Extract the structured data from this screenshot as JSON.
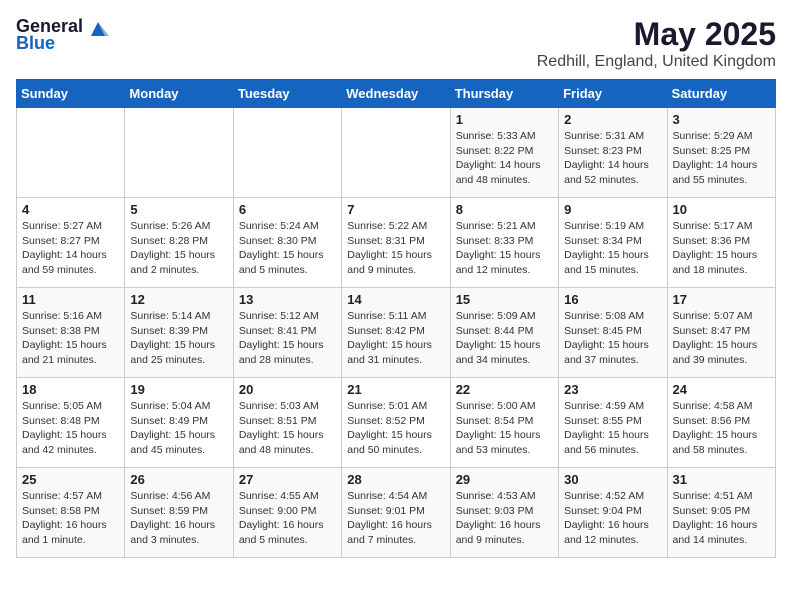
{
  "logo": {
    "general": "General",
    "blue": "Blue"
  },
  "title": "May 2025",
  "subtitle": "Redhill, England, United Kingdom",
  "headers": [
    "Sunday",
    "Monday",
    "Tuesday",
    "Wednesday",
    "Thursday",
    "Friday",
    "Saturday"
  ],
  "weeks": [
    [
      {
        "day": "",
        "info": ""
      },
      {
        "day": "",
        "info": ""
      },
      {
        "day": "",
        "info": ""
      },
      {
        "day": "",
        "info": ""
      },
      {
        "day": "1",
        "info": "Sunrise: 5:33 AM\nSunset: 8:22 PM\nDaylight: 14 hours\nand 48 minutes."
      },
      {
        "day": "2",
        "info": "Sunrise: 5:31 AM\nSunset: 8:23 PM\nDaylight: 14 hours\nand 52 minutes."
      },
      {
        "day": "3",
        "info": "Sunrise: 5:29 AM\nSunset: 8:25 PM\nDaylight: 14 hours\nand 55 minutes."
      }
    ],
    [
      {
        "day": "4",
        "info": "Sunrise: 5:27 AM\nSunset: 8:27 PM\nDaylight: 14 hours\nand 59 minutes."
      },
      {
        "day": "5",
        "info": "Sunrise: 5:26 AM\nSunset: 8:28 PM\nDaylight: 15 hours\nand 2 minutes."
      },
      {
        "day": "6",
        "info": "Sunrise: 5:24 AM\nSunset: 8:30 PM\nDaylight: 15 hours\nand 5 minutes."
      },
      {
        "day": "7",
        "info": "Sunrise: 5:22 AM\nSunset: 8:31 PM\nDaylight: 15 hours\nand 9 minutes."
      },
      {
        "day": "8",
        "info": "Sunrise: 5:21 AM\nSunset: 8:33 PM\nDaylight: 15 hours\nand 12 minutes."
      },
      {
        "day": "9",
        "info": "Sunrise: 5:19 AM\nSunset: 8:34 PM\nDaylight: 15 hours\nand 15 minutes."
      },
      {
        "day": "10",
        "info": "Sunrise: 5:17 AM\nSunset: 8:36 PM\nDaylight: 15 hours\nand 18 minutes."
      }
    ],
    [
      {
        "day": "11",
        "info": "Sunrise: 5:16 AM\nSunset: 8:38 PM\nDaylight: 15 hours\nand 21 minutes."
      },
      {
        "day": "12",
        "info": "Sunrise: 5:14 AM\nSunset: 8:39 PM\nDaylight: 15 hours\nand 25 minutes."
      },
      {
        "day": "13",
        "info": "Sunrise: 5:12 AM\nSunset: 8:41 PM\nDaylight: 15 hours\nand 28 minutes."
      },
      {
        "day": "14",
        "info": "Sunrise: 5:11 AM\nSunset: 8:42 PM\nDaylight: 15 hours\nand 31 minutes."
      },
      {
        "day": "15",
        "info": "Sunrise: 5:09 AM\nSunset: 8:44 PM\nDaylight: 15 hours\nand 34 minutes."
      },
      {
        "day": "16",
        "info": "Sunrise: 5:08 AM\nSunset: 8:45 PM\nDaylight: 15 hours\nand 37 minutes."
      },
      {
        "day": "17",
        "info": "Sunrise: 5:07 AM\nSunset: 8:47 PM\nDaylight: 15 hours\nand 39 minutes."
      }
    ],
    [
      {
        "day": "18",
        "info": "Sunrise: 5:05 AM\nSunset: 8:48 PM\nDaylight: 15 hours\nand 42 minutes."
      },
      {
        "day": "19",
        "info": "Sunrise: 5:04 AM\nSunset: 8:49 PM\nDaylight: 15 hours\nand 45 minutes."
      },
      {
        "day": "20",
        "info": "Sunrise: 5:03 AM\nSunset: 8:51 PM\nDaylight: 15 hours\nand 48 minutes."
      },
      {
        "day": "21",
        "info": "Sunrise: 5:01 AM\nSunset: 8:52 PM\nDaylight: 15 hours\nand 50 minutes."
      },
      {
        "day": "22",
        "info": "Sunrise: 5:00 AM\nSunset: 8:54 PM\nDaylight: 15 hours\nand 53 minutes."
      },
      {
        "day": "23",
        "info": "Sunrise: 4:59 AM\nSunset: 8:55 PM\nDaylight: 15 hours\nand 56 minutes."
      },
      {
        "day": "24",
        "info": "Sunrise: 4:58 AM\nSunset: 8:56 PM\nDaylight: 15 hours\nand 58 minutes."
      }
    ],
    [
      {
        "day": "25",
        "info": "Sunrise: 4:57 AM\nSunset: 8:58 PM\nDaylight: 16 hours\nand 1 minute."
      },
      {
        "day": "26",
        "info": "Sunrise: 4:56 AM\nSunset: 8:59 PM\nDaylight: 16 hours\nand 3 minutes."
      },
      {
        "day": "27",
        "info": "Sunrise: 4:55 AM\nSunset: 9:00 PM\nDaylight: 16 hours\nand 5 minutes."
      },
      {
        "day": "28",
        "info": "Sunrise: 4:54 AM\nSunset: 9:01 PM\nDaylight: 16 hours\nand 7 minutes."
      },
      {
        "day": "29",
        "info": "Sunrise: 4:53 AM\nSunset: 9:03 PM\nDaylight: 16 hours\nand 9 minutes."
      },
      {
        "day": "30",
        "info": "Sunrise: 4:52 AM\nSunset: 9:04 PM\nDaylight: 16 hours\nand 12 minutes."
      },
      {
        "day": "31",
        "info": "Sunrise: 4:51 AM\nSunset: 9:05 PM\nDaylight: 16 hours\nand 14 minutes."
      }
    ]
  ]
}
